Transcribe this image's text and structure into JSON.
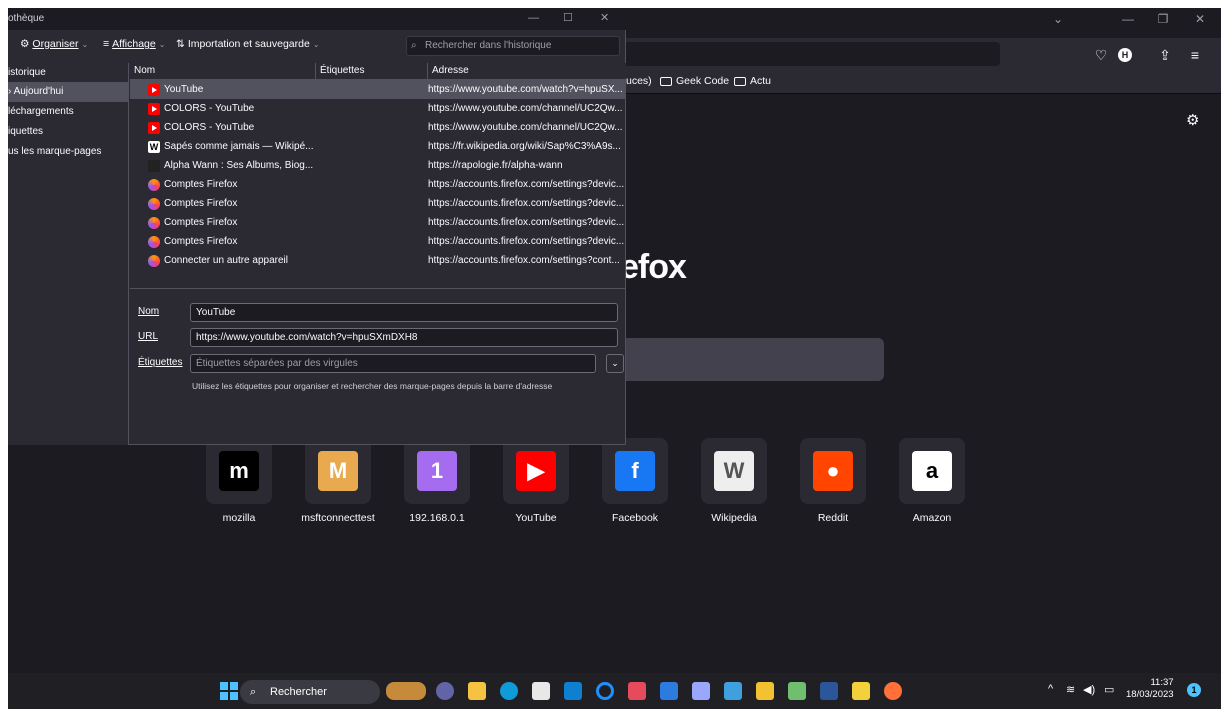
{
  "library": {
    "title": "othèque",
    "menu": {
      "organise": "Organiser",
      "view": "Affichage",
      "import": "Importation et sauvegarde"
    },
    "search_placeholder": "Rechercher dans l'historique",
    "left_items": [
      "istorique",
      "Aujourd'hui",
      "léchargements",
      "iquettes",
      "us les marque-pages"
    ],
    "columns": {
      "name": "Nom",
      "tags": "Étiquettes",
      "address": "Adresse"
    },
    "rows": [
      {
        "icon": "youtube-icon",
        "name": "YouTube",
        "address": "https://www.youtube.com/watch?v=hpuSX..."
      },
      {
        "icon": "youtube-icon",
        "name": "COLORS - YouTube",
        "address": "https://www.youtube.com/channel/UC2Qw..."
      },
      {
        "icon": "youtube-icon",
        "name": "COLORS - YouTube",
        "address": "https://www.youtube.com/channel/UC2Qw..."
      },
      {
        "icon": "wikipedia-icon",
        "name": "Sapés comme jamais — Wikipé...",
        "address": "https://fr.wikipedia.org/wiki/Sap%C3%A9s..."
      },
      {
        "icon": "rapologie-icon",
        "name": "Alpha Wann : Ses Albums, Biog...",
        "address": "https://rapologie.fr/alpha-wann"
      },
      {
        "icon": "firefox-account-icon",
        "name": "Comptes Firefox",
        "address": "https://accounts.firefox.com/settings?devic..."
      },
      {
        "icon": "firefox-account-icon",
        "name": "Comptes Firefox",
        "address": "https://accounts.firefox.com/settings?devic..."
      },
      {
        "icon": "firefox-account-icon",
        "name": "Comptes Firefox",
        "address": "https://accounts.firefox.com/settings?devic..."
      },
      {
        "icon": "firefox-account-icon",
        "name": "Comptes Firefox",
        "address": "https://accounts.firefox.com/settings?devic..."
      },
      {
        "icon": "firefox-account-icon",
        "name": "Connecter un autre appareil",
        "address": "https://accounts.firefox.com/settings?cont..."
      }
    ],
    "details": {
      "name_label": "Nom",
      "name_value": "YouTube",
      "url_label": "URL",
      "url_value": "https://www.youtube.com/watch?v=hpuSXmDXH8",
      "tags_label": "Étiquettes",
      "tags_placeholder": "Étiquettes séparées par des virgules",
      "hint": "Utilisez les étiquettes pour organiser et rechercher des marque-pages depuis la barre d'adresse"
    }
  },
  "browser": {
    "bookmarks": [
      "uces)",
      "Geek Code",
      "Actu"
    ],
    "logo_text": "efox",
    "tiles": [
      {
        "label": "mozilla",
        "glyph": "m",
        "bg": "#000000",
        "fg": "#ffffff"
      },
      {
        "label": "msftconnecttest",
        "glyph": "M",
        "bg": "#e8a94f",
        "fg": "#ffffff"
      },
      {
        "label": "192.168.0.1",
        "glyph": "1",
        "bg": "#a56cf0",
        "fg": "#ffffff"
      },
      {
        "label": "YouTube",
        "glyph": "▶",
        "bg": "#ff0000",
        "fg": "#ffffff"
      },
      {
        "label": "Facebook",
        "glyph": "f",
        "bg": "#1877f2",
        "fg": "#ffffff"
      },
      {
        "label": "Wikipedia",
        "glyph": "W",
        "bg": "#eeeeee",
        "fg": "#555555"
      },
      {
        "label": "Reddit",
        "glyph": "●",
        "bg": "#ff4500",
        "fg": "#ffffff"
      },
      {
        "label": "Amazon",
        "glyph": "a",
        "bg": "#ffffff",
        "fg": "#000000"
      }
    ]
  },
  "taskbar": {
    "search": "Rechercher",
    "time": "11:37",
    "date": "18/03/2023",
    "notifications": "1"
  }
}
